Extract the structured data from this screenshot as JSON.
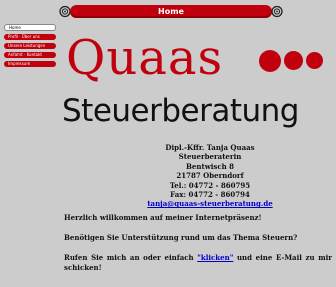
{
  "topbar": {
    "home_label": "Home"
  },
  "nav": {
    "items": [
      {
        "label": "Home",
        "active": true
      },
      {
        "label": "Profil · Über uns"
      },
      {
        "label": "Unsere Leistungen"
      },
      {
        "label": "Anfahrt · Kontakt"
      },
      {
        "label": "Impressum"
      }
    ]
  },
  "logo": {
    "name": "Quaas",
    "subtitle": "Steuerberatung"
  },
  "address": {
    "name": "Dipl.-Kffr. Tanja Quaas",
    "title": "Steuerberaterin",
    "street": "Bentwisch 8",
    "city": "21787 Oberndorf",
    "tel": "Tel.: 04772 - 860795",
    "fax": "Fax: 04772 - 860794",
    "email": "tanja@quaas-steuerberatung.de"
  },
  "content": {
    "welcome": "Herzlich willkommen auf meiner Internetpräsenz!",
    "question": "Benötigen Sie Unterstützung rund um das Thema Steuern?",
    "call_pre": "Rufen Sie mich an oder einfach ",
    "call_link": "\"klicken\"",
    "call_post": " und eine E-Mail zu mir schicken!"
  },
  "colors": {
    "brand_red": "#c0000d",
    "background": "#cccccc",
    "link": "#0000cc"
  }
}
